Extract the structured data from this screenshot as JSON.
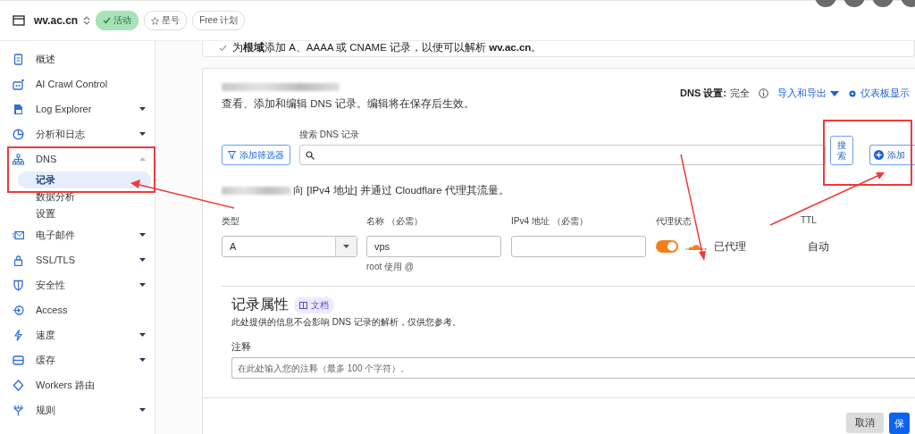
{
  "header": {
    "domain": "wv.ac.cn",
    "badges": [
      {
        "kind": "status",
        "label": "活动"
      },
      {
        "kind": "star",
        "label": "星号"
      },
      {
        "kind": "plan",
        "label": "Free 计划"
      }
    ]
  },
  "sidebar": {
    "items": [
      {
        "label": "概述",
        "selected": false
      },
      {
        "label": "AI Crawl Control",
        "selected": false
      },
      {
        "label": "Log Explorer",
        "selected": false,
        "expanded": false
      },
      {
        "label": "分析和日志",
        "selected": false,
        "expanded": false
      },
      {
        "label": "DNS",
        "selected": false,
        "expanded": true,
        "children": [
          {
            "label": "记录",
            "selected": true
          },
          {
            "label": "数据分析",
            "selected": false
          },
          {
            "label": "设置",
            "selected": false
          }
        ]
      },
      {
        "label": "电子邮件",
        "selected": false,
        "expanded": false
      },
      {
        "label": "SSL/TLS",
        "selected": false,
        "expanded": false
      },
      {
        "label": "安全性",
        "selected": false,
        "expanded": false
      },
      {
        "label": "Access",
        "selected": false
      },
      {
        "label": "速度",
        "selected": false,
        "expanded": false
      },
      {
        "label": "缓存",
        "selected": false,
        "expanded": false
      },
      {
        "label": "Workers 路由",
        "selected": false
      },
      {
        "label": "规则",
        "selected": false,
        "expanded": false
      }
    ]
  },
  "notice": {
    "text": "为**根域**添加 A、AAAA 或 CNAME 记录，以便可以解析 **wv.ac.cn**。"
  },
  "records_panel": {
    "description": "查看、添加和编辑 DNS 记录。编辑将在保存后生效。",
    "dns_setup": {
      "label": "DNS 设置:",
      "value": "完全"
    },
    "import_export": "导入和导出",
    "dashboard_settings": "仪表板显示",
    "filter_button": "添加筛选器",
    "search_label": "搜索 DNS 记录",
    "search_button": "搜索",
    "add_button": "添加",
    "hint": "向 [IPv4 地址] 并通过 Cloudflare 代理其流量。",
    "form": {
      "type_label": "类型",
      "type_value": "A",
      "name_label": "名称 （必需）",
      "name_value": "vps",
      "name_help": "root 使用 @",
      "ipv4_label": "IPv4 地址 （必需）",
      "proxy_label": "代理状态",
      "proxy_on": true,
      "proxy_text": "已代理",
      "ttl_label": "TTL",
      "ttl_value": "自动"
    },
    "attributes": {
      "title": "记录属性",
      "docs_badge": "文档",
      "description": "此处提供的信息不会影响 DNS 记录的解析，仅供您参考。",
      "comment_label": "注释",
      "comment_placeholder": "在此处输入您的注释（最多 100 个字符）。"
    },
    "cancel_button": "取消",
    "save_button": "保"
  },
  "annotations": [
    {
      "kind": "box"
    },
    {
      "kind": "box"
    },
    {
      "kind": "arrow"
    },
    {
      "kind": "arrow"
    },
    {
      "kind": "arrow"
    }
  ]
}
